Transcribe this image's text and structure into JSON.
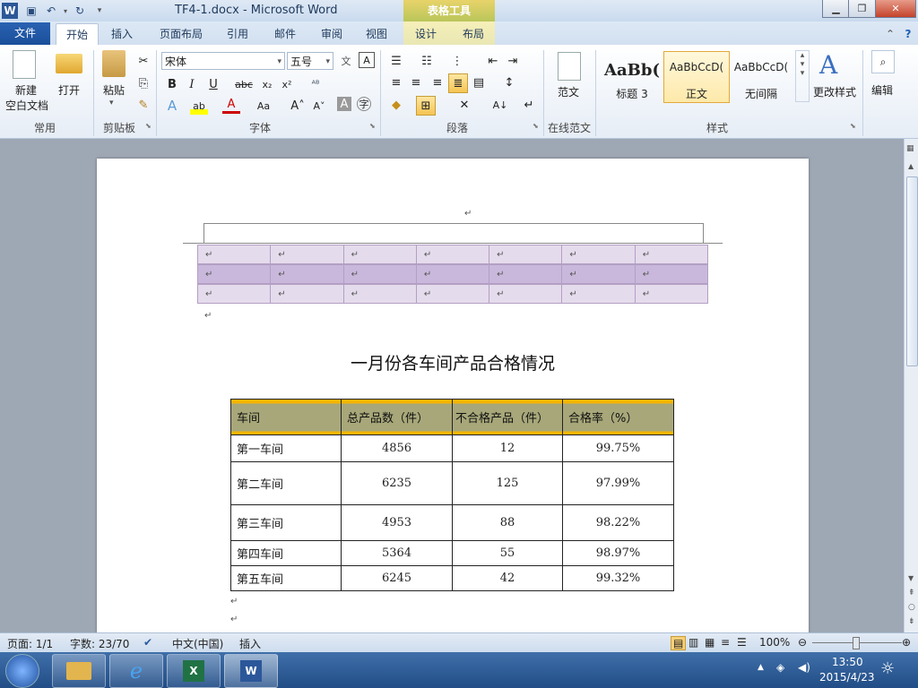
{
  "window": {
    "doc_title": "TF4-1.docx - Microsoft Word",
    "context_group": "表格工具"
  },
  "tabs": [
    "文件",
    "开始",
    "插入",
    "页面布局",
    "引用",
    "邮件",
    "审阅",
    "视图",
    "设计",
    "布局"
  ],
  "ribbon": {
    "groups": {
      "common": "常用",
      "clipboard": "剪贴板",
      "font": "字体",
      "paragraph": "段落",
      "online": "在线范文",
      "styles": "样式"
    },
    "new_blank_line1": "新建",
    "new_blank_line2": "空白文档",
    "open": "打开",
    "paste": "粘贴",
    "font_name": "宋体",
    "font_size": "五号",
    "sample": "范文",
    "change_styles": "更改样式",
    "edit": "编辑",
    "style_items": [
      {
        "sample": "AaBb(",
        "name": "标题 3"
      },
      {
        "sample": "AaBbCcD(",
        "name": "正文"
      },
      {
        "sample": "AaBbCcD(",
        "name": "无间隔"
      }
    ]
  },
  "document": {
    "heading": "一月份各车间产品合格情况",
    "table": {
      "headers": [
        "车间",
        "总产品数（件）",
        "不合格产品（件）",
        "合格率（%）"
      ],
      "rows": [
        [
          "第一车间",
          "4856",
          "12",
          "99.75%"
        ],
        [
          "第二车间",
          "6235",
          "125",
          "97.99%"
        ],
        [
          "第三车间",
          "4953",
          "88",
          "98.22%"
        ],
        [
          "第四车间",
          "5364",
          "55",
          "98.97%"
        ],
        [
          "第五车间",
          "6245",
          "42",
          "99.32%"
        ]
      ]
    }
  },
  "status": {
    "page": "页面: 1/1",
    "words": "字数: 23/70",
    "lang": "中文(中国)",
    "mode": "插入",
    "zoom": "100%"
  },
  "taskbar": {
    "time": "13:50",
    "date": "2015/4/23"
  },
  "colors": {
    "header_gold": "#f6b500",
    "header_olive": "#a7a77a",
    "table1_fill_a": "#e4dbec",
    "table1_fill_b": "#c9b8db"
  }
}
